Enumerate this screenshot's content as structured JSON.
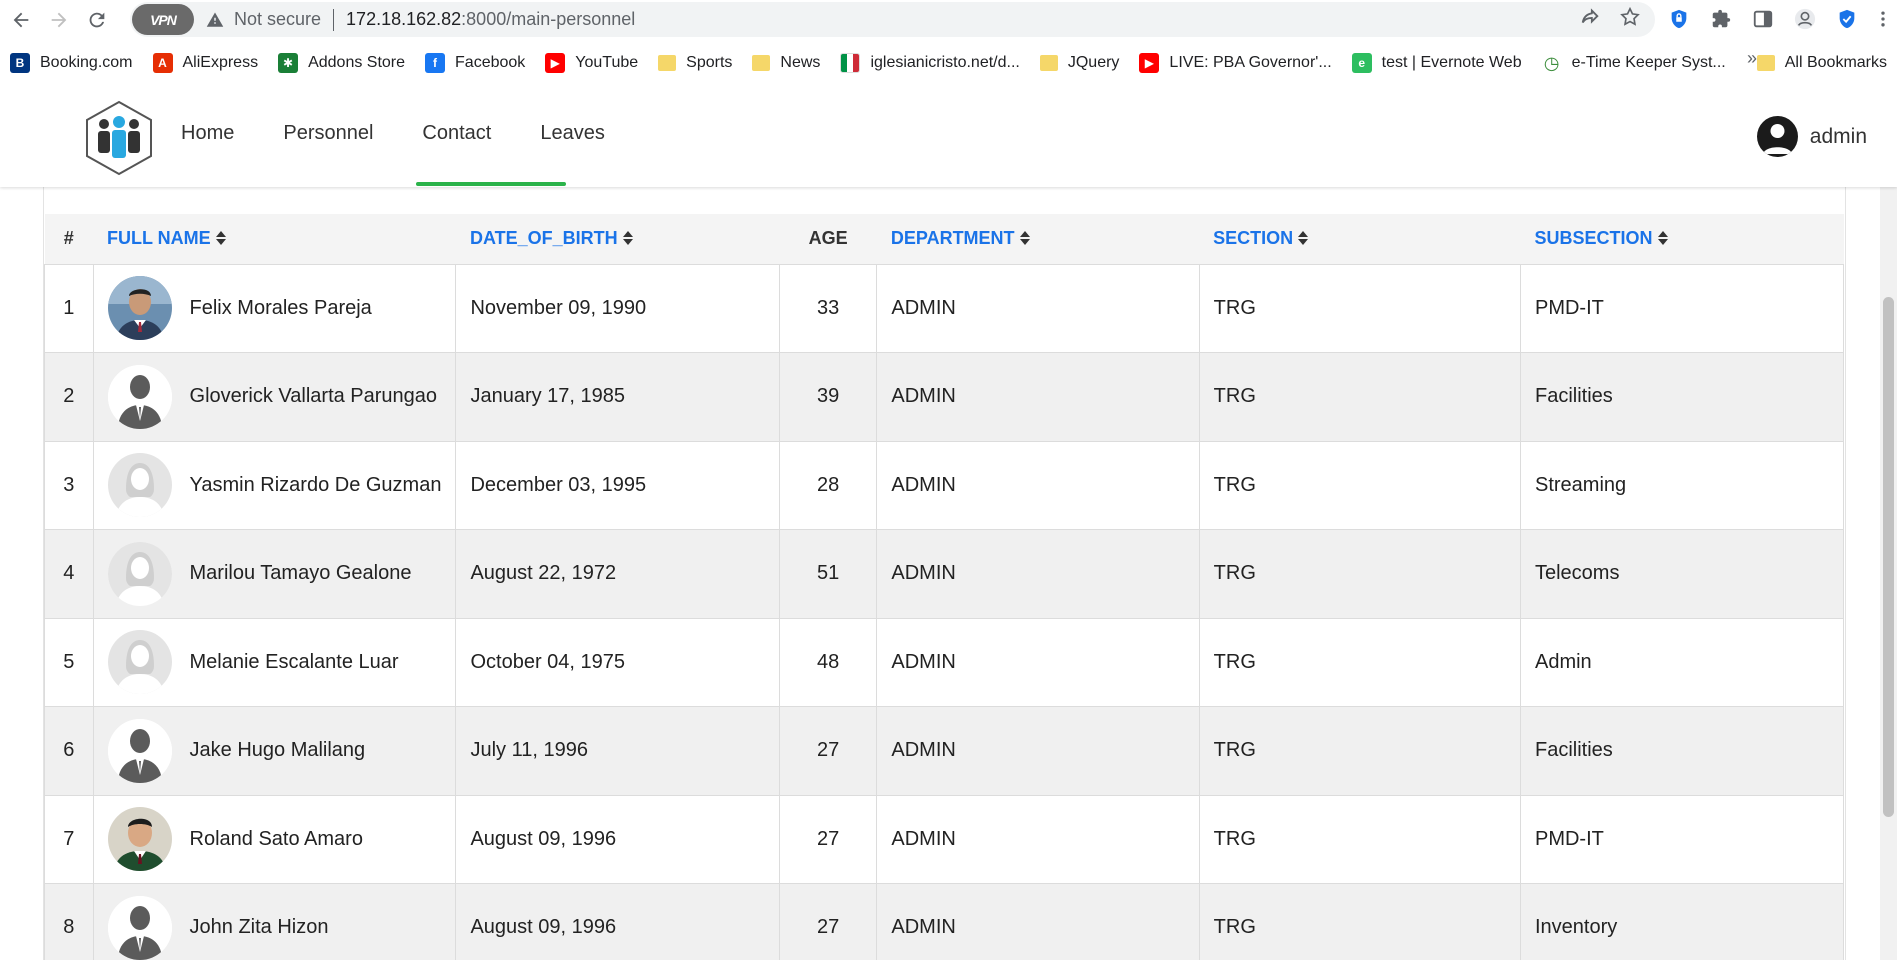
{
  "browser": {
    "vpn_label": "VPN",
    "security_text": "Not secure",
    "url_host": "172.18.162.82",
    "url_path": ":8000/main-personnel",
    "bookmarks": [
      {
        "label": "Booking.com",
        "icon": "booking-icon",
        "color": "#003580"
      },
      {
        "label": "AliExpress",
        "icon": "aliexpress-icon",
        "color": "#e62e04"
      },
      {
        "label": "Addons Store",
        "icon": "addons-store-icon",
        "color": "#1a7f37"
      },
      {
        "label": "Facebook",
        "icon": "facebook-icon",
        "color": "#1877f2"
      },
      {
        "label": "YouTube",
        "icon": "youtube-icon",
        "color": "#ff0000"
      },
      {
        "label": "Sports",
        "icon": "folder-icon",
        "color": "#f5d769"
      },
      {
        "label": "News",
        "icon": "folder-icon",
        "color": "#f5d769"
      },
      {
        "label": "iglesianicristo.net/d...",
        "icon": "italy-flag-icon",
        "color": "#009246"
      },
      {
        "label": "JQuery",
        "icon": "folder-icon",
        "color": "#f5d769"
      },
      {
        "label": "LIVE: PBA Governor'...",
        "icon": "youtube-icon",
        "color": "#ff0000"
      },
      {
        "label": "test | Evernote Web",
        "icon": "evernote-icon",
        "color": "#2dbe60"
      },
      {
        "label": "e-Time Keeper Syst...",
        "icon": "clock-icon",
        "color": "#3c8d3c"
      }
    ],
    "more_bookmarks": "»",
    "all_bookmarks": "All Bookmarks"
  },
  "navbar": {
    "links": [
      "Home",
      "Personnel",
      "Contact",
      "Leaves"
    ],
    "user_name": "admin"
  },
  "table": {
    "headers": {
      "num": "#",
      "full_name": "FULL NAME",
      "dob": "DATE_OF_BIRTH",
      "age": "AGE",
      "department": "DEPARTMENT",
      "section": "SECTION",
      "subsection": "SUBSECTION"
    },
    "rows": [
      {
        "num": "1",
        "name": "Felix Morales Pareja",
        "dob": "November 09, 1990",
        "age": "33",
        "department": "ADMIN",
        "section": "TRG",
        "subsection": "PMD-IT",
        "avatar": "photo-male-1"
      },
      {
        "num": "2",
        "name": "Gloverick Vallarta Parungao",
        "dob": "January 17, 1985",
        "age": "39",
        "department": "ADMIN",
        "section": "TRG",
        "subsection": "Facilities",
        "avatar": "male-silhouette"
      },
      {
        "num": "3",
        "name": "Yasmin Rizardo De Guzman",
        "dob": "December 03, 1995",
        "age": "28",
        "department": "ADMIN",
        "section": "TRG",
        "subsection": "Streaming",
        "avatar": "female-silhouette"
      },
      {
        "num": "4",
        "name": "Marilou Tamayo Gealone",
        "dob": "August 22, 1972",
        "age": "51",
        "department": "ADMIN",
        "section": "TRG",
        "subsection": "Telecoms",
        "avatar": "female-silhouette"
      },
      {
        "num": "5",
        "name": "Melanie Escalante Luar",
        "dob": "October 04, 1975",
        "age": "48",
        "department": "ADMIN",
        "section": "TRG",
        "subsection": "Admin",
        "avatar": "female-silhouette"
      },
      {
        "num": "6",
        "name": "Jake Hugo Malilang",
        "dob": "July 11, 1996",
        "age": "27",
        "department": "ADMIN",
        "section": "TRG",
        "subsection": "Facilities",
        "avatar": "male-silhouette"
      },
      {
        "num": "7",
        "name": "Roland Sato Amaro",
        "dob": "August 09, 1996",
        "age": "27",
        "department": "ADMIN",
        "section": "TRG",
        "subsection": "PMD-IT",
        "avatar": "photo-male-2"
      },
      {
        "num": "8",
        "name": "John Zita Hizon",
        "dob": "August 09, 1996",
        "age": "27",
        "department": "ADMIN",
        "section": "TRG",
        "subsection": "Inventory",
        "avatar": "male-silhouette"
      }
    ]
  },
  "colors": {
    "link_blue": "#1a73e8",
    "active_green": "#2bb34a",
    "stripe_gray": "#f0f0f0"
  }
}
